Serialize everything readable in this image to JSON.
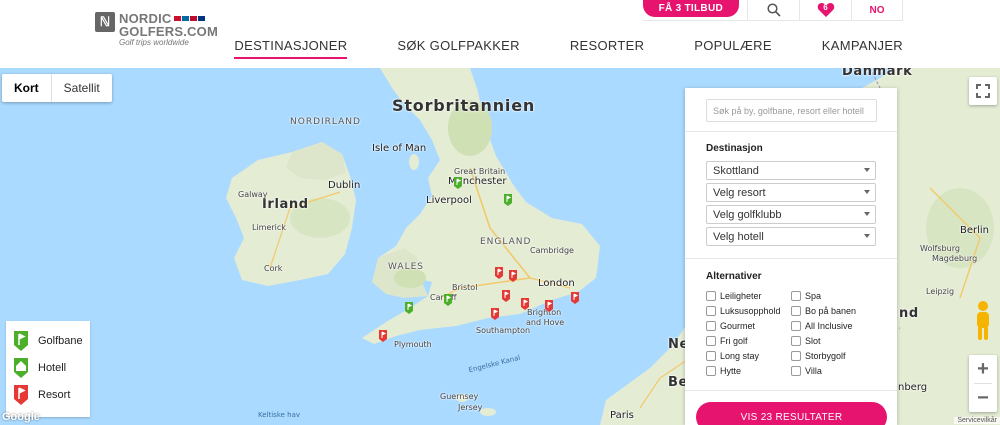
{
  "brand": {
    "line1": "NORDIC",
    "line2": "GOLFERS.COM",
    "tagline": "Golf trips worldwide"
  },
  "topbar": {
    "offer_label": "FÅ 3 TILBUD",
    "search_icon": "search-icon",
    "favorites_count": "6",
    "language": "NO"
  },
  "nav": {
    "items": [
      {
        "label": "DESTINASJONER",
        "active": true
      },
      {
        "label": "SØK GOLFPAKKER",
        "active": false
      },
      {
        "label": "RESORTER",
        "active": false
      },
      {
        "label": "POPULÆRE",
        "active": false
      },
      {
        "label": "KAMPANJER",
        "active": false
      }
    ]
  },
  "map": {
    "type_options": [
      "Kort",
      "Satellit"
    ],
    "selected_type": "Kort",
    "labels": {
      "storbritannien": "Storbritannien",
      "nordirland": "NORDIRLAND",
      "isle_of_man": "Isle of Man",
      "irland": "Irland",
      "dublin": "Dublin",
      "galway": "Galway",
      "limerick": "Limerick",
      "cork": "Cork",
      "great_britain": "Great Britain",
      "manchester": "Manchester",
      "liverpool": "Liverpool",
      "england": "ENGLAND",
      "wales": "WALES",
      "cambridge": "Cambridge",
      "bristol": "Bristol",
      "cardiff": "Cardiff",
      "london": "London",
      "brighton": "Brighton",
      "and_hove": "and Hove",
      "southampton": "Southampton",
      "plymouth": "Plymouth",
      "engelske_kanal": "Engelske Kanal",
      "guernsey": "Guernsey",
      "jersey": "Jersey",
      "keltiske_hav": "Keltiske hav",
      "paris": "Paris",
      "danmark": "Danmark",
      "berlin": "Berlin",
      "wolfsburg": "Wolfsburg",
      "magdeburg": "Magdeburg",
      "leipzig": "Leipzig",
      "nd": "nd",
      "nberg": "nberg",
      "ne": "Ne",
      "be": "Be"
    },
    "google": "Google",
    "attribution": "Servicevilkår"
  },
  "legend": {
    "items": [
      {
        "label": "Golfbane",
        "icon": "golf-flag-icon",
        "color": "#4caf2a"
      },
      {
        "label": "Hotell",
        "icon": "hotel-icon",
        "color": "#4caf2a"
      },
      {
        "label": "Resort",
        "icon": "resort-icon",
        "color": "#e53935"
      }
    ]
  },
  "filters": {
    "search_placeholder": "Søk på by, golfbane, resort eller hotell",
    "destination_title": "Destinasjon",
    "selects": [
      "Skottland",
      "Velg resort",
      "Velg golfklubb",
      "Velg hotell"
    ],
    "alternatives_title": "Alternativer",
    "options_left": [
      "Leiligheter",
      "Luksusopphold",
      "Gourmet",
      "Fri golf",
      "Long stay",
      "Hytte"
    ],
    "options_right": [
      "Spa",
      "Bo på banen",
      "All Inclusive",
      "Slot",
      "Storbygolf",
      "Villa"
    ],
    "result_button": "VIS 23 RESULTATER"
  },
  "colors": {
    "accent": "#e6136f",
    "water": "#aadaff",
    "land": "#e6ecd8"
  }
}
